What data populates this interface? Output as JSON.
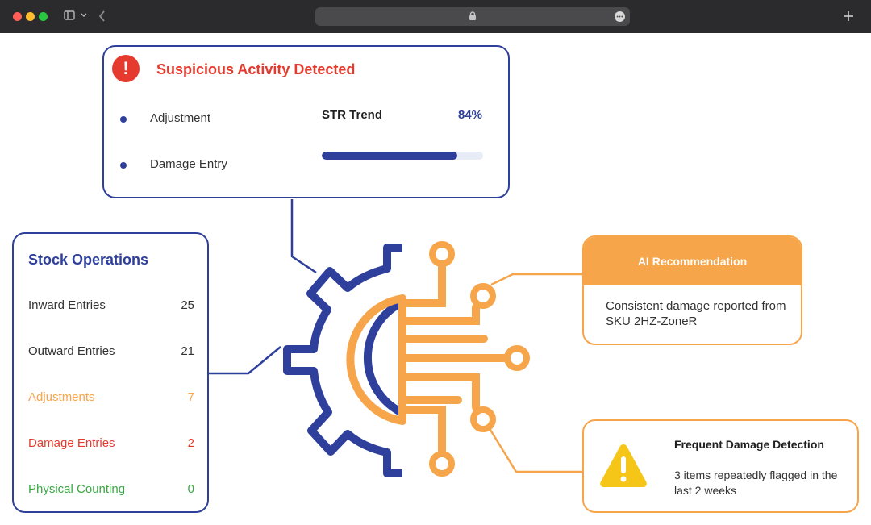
{
  "suspicious": {
    "title": "Suspicious Activity Detected",
    "items": [
      "Adjustment",
      "Damage Entry"
    ],
    "trend_label": "STR Trend",
    "trend_value": "84%",
    "trend_fraction": 0.84
  },
  "stock": {
    "title": "Stock Operations",
    "rows": [
      {
        "label": "Inward Entries",
        "value": "25"
      },
      {
        "label": "Outward Entries",
        "value": "21"
      },
      {
        "label": "Adjustments",
        "value": "7"
      },
      {
        "label": "Damage Entries",
        "value": "2"
      },
      {
        "label": "Physical Counting",
        "value": "0"
      }
    ]
  },
  "ai": {
    "title": "AI Recommendation",
    "body": "Consistent damage reported from SKU 2HZ-ZoneR"
  },
  "damage": {
    "title": "Frequent Damage Detection",
    "body": "3 items repeatedly flagged in the last 2 weeks"
  },
  "colors": {
    "blue": "#2e3f9c",
    "orange": "#f7a54a",
    "red": "#e53b2f",
    "green": "#3aa843",
    "yellow": "#f5c518",
    "text": "#333333"
  },
  "icons": [
    "sidebar-icon",
    "chevron-down-icon",
    "back-icon",
    "lock-icon",
    "more-icon",
    "plus-icon",
    "exclamation-icon",
    "warning-icon",
    "gear-circuit-icon"
  ]
}
